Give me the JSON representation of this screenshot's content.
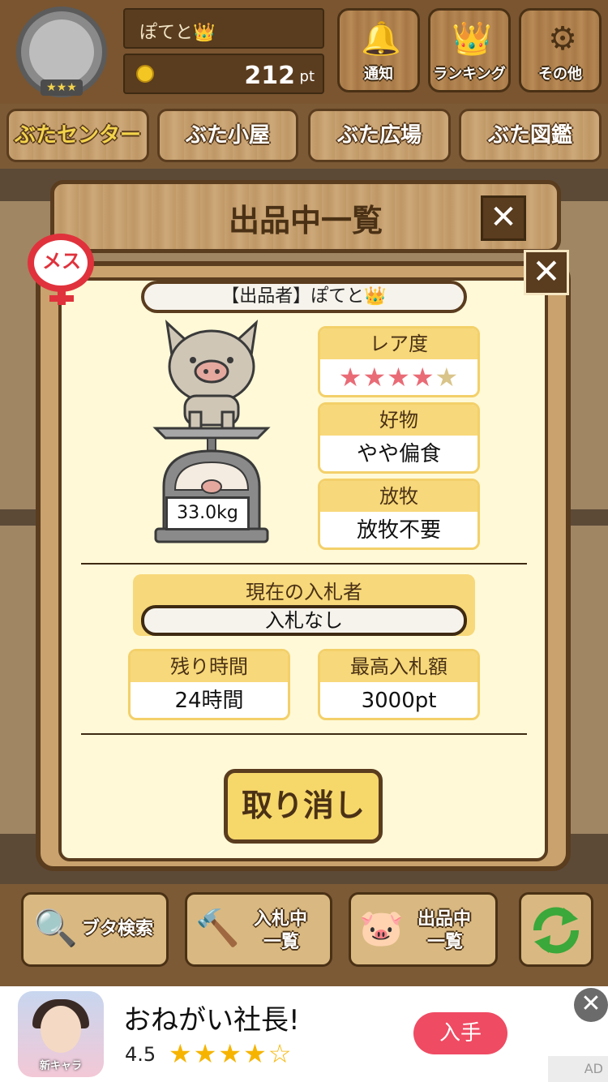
{
  "header": {
    "user_name": "ぽてと",
    "user_crown": "👑",
    "avatar_stars": "★★★",
    "points_value": "212",
    "points_unit": "pt",
    "buttons": [
      {
        "label": "通知",
        "icon": "bell-icon",
        "glyph": "🔔"
      },
      {
        "label": "ランキング",
        "icon": "crown-icon",
        "glyph": "👑"
      },
      {
        "label": "その他",
        "icon": "gear-icon",
        "glyph": "⚙"
      }
    ]
  },
  "tabs": [
    {
      "label": "ぶたセンター",
      "active": true
    },
    {
      "label": "ぶた小屋",
      "active": false
    },
    {
      "label": "ぶた広場",
      "active": false
    },
    {
      "label": "ぶた図鑑",
      "active": false
    }
  ],
  "back_dialog": {
    "title": "出品中一覧",
    "close": "✕"
  },
  "dialog": {
    "close": "✕",
    "gender": "メス",
    "seller_label": "【出品者】ぽてと",
    "seller_crown": "👑",
    "weight": "33.0kg",
    "rarity": {
      "title": "レア度",
      "filled": "★★★★",
      "empty": "★"
    },
    "favorite": {
      "title": "好物",
      "value": "やや偏食"
    },
    "grazing": {
      "title": "放牧",
      "value": "放牧不要"
    },
    "bidder": {
      "title": "現在の入札者",
      "value": "入札なし"
    },
    "remaining": {
      "title": "残り時間",
      "value": "24時間"
    },
    "max_bid": {
      "title": "最高入札額",
      "value": "3000pt"
    },
    "cancel_label": "取り消し"
  },
  "toolbar": {
    "search_label": "ブタ検索",
    "bidding_label_1": "入札中",
    "bidding_label_2": "一覧",
    "listing_label_1": "出品中",
    "listing_label_2": "一覧",
    "refresh_icon": "refresh-icon"
  },
  "ad": {
    "title": "おねがい社長!",
    "icon_tag": "新キャラ",
    "rating": "4.5",
    "stars": "★★★★☆",
    "get_label": "入手",
    "close": "✕",
    "mark": "AD"
  },
  "colors": {
    "wood": "#b38552",
    "panel": "#fff9d7",
    "accent_yellow": "#f7d87a",
    "gender_red": "#e0323c",
    "ad_button": "#ef4b63"
  }
}
